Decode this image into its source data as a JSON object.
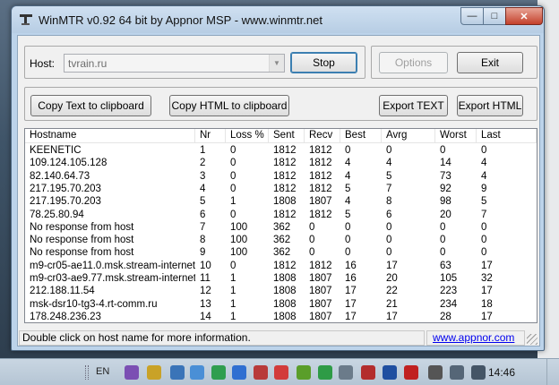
{
  "window": {
    "title": "WinMTR v0.92 64 bit by Appnor MSP - www.winmtr.net",
    "minimize": "—",
    "maximize": "□",
    "close": "✕"
  },
  "host": {
    "label": "Host:",
    "value": "tvrain.ru"
  },
  "buttons": {
    "stop": "Stop",
    "options": "Options",
    "exit": "Exit",
    "copy_text": "Copy Text to clipboard",
    "copy_html": "Copy HTML to clipboard",
    "export_text": "Export TEXT",
    "export_html": "Export HTML"
  },
  "columns": [
    "Hostname",
    "Nr",
    "Loss %",
    "Sent",
    "Recv",
    "Best",
    "Avrg",
    "Worst",
    "Last"
  ],
  "rows": [
    [
      "KEENETIC",
      "1",
      "0",
      "1812",
      "1812",
      "0",
      "0",
      "0",
      "0"
    ],
    [
      "109.124.105.128",
      "2",
      "0",
      "1812",
      "1812",
      "4",
      "4",
      "14",
      "4"
    ],
    [
      "82.140.64.73",
      "3",
      "0",
      "1812",
      "1812",
      "4",
      "5",
      "73",
      "4"
    ],
    [
      "217.195.70.203",
      "4",
      "0",
      "1812",
      "1812",
      "5",
      "7",
      "92",
      "9"
    ],
    [
      "217.195.70.203",
      "5",
      "1",
      "1808",
      "1807",
      "4",
      "8",
      "98",
      "5"
    ],
    [
      "78.25.80.94",
      "6",
      "0",
      "1812",
      "1812",
      "5",
      "6",
      "20",
      "7"
    ],
    [
      "No response from host",
      "7",
      "100",
      "362",
      "0",
      "0",
      "0",
      "0",
      "0"
    ],
    [
      "No response from host",
      "8",
      "100",
      "362",
      "0",
      "0",
      "0",
      "0",
      "0"
    ],
    [
      "No response from host",
      "9",
      "100",
      "362",
      "0",
      "0",
      "0",
      "0",
      "0"
    ],
    [
      "m9-cr05-ae11.0.msk.stream-internet....",
      "10",
      "0",
      "1812",
      "1812",
      "16",
      "17",
      "63",
      "17"
    ],
    [
      "m9-cr03-ae9.77.msk.stream-internet....",
      "11",
      "1",
      "1808",
      "1807",
      "16",
      "20",
      "105",
      "32"
    ],
    [
      "212.188.11.54",
      "12",
      "1",
      "1808",
      "1807",
      "17",
      "22",
      "223",
      "17"
    ],
    [
      "msk-dsr10-tg3-4.rt-comm.ru",
      "13",
      "1",
      "1808",
      "1807",
      "17",
      "21",
      "234",
      "18"
    ],
    [
      "178.248.236.23",
      "14",
      "1",
      "1808",
      "1807",
      "17",
      "17",
      "28",
      "17"
    ]
  ],
  "status": {
    "message": "Double click on host name for more information.",
    "link": "www.appnor.com"
  },
  "taskbar": {
    "language": "EN",
    "clock": "14:46",
    "tray_icons": [
      "viber-icon",
      "clipboard-icon",
      "image-icon",
      "cloud-icon",
      "google-drive-icon",
      "dropbox-icon",
      "app-icon",
      "red-app-icon",
      "nvidia-icon",
      "green-check-icon",
      "gear-icon",
      "red-disk-icon",
      "red-disk-icon-2",
      "en-badge-icon",
      "flag-icon",
      "monitor-icon",
      "volume-icon"
    ]
  }
}
